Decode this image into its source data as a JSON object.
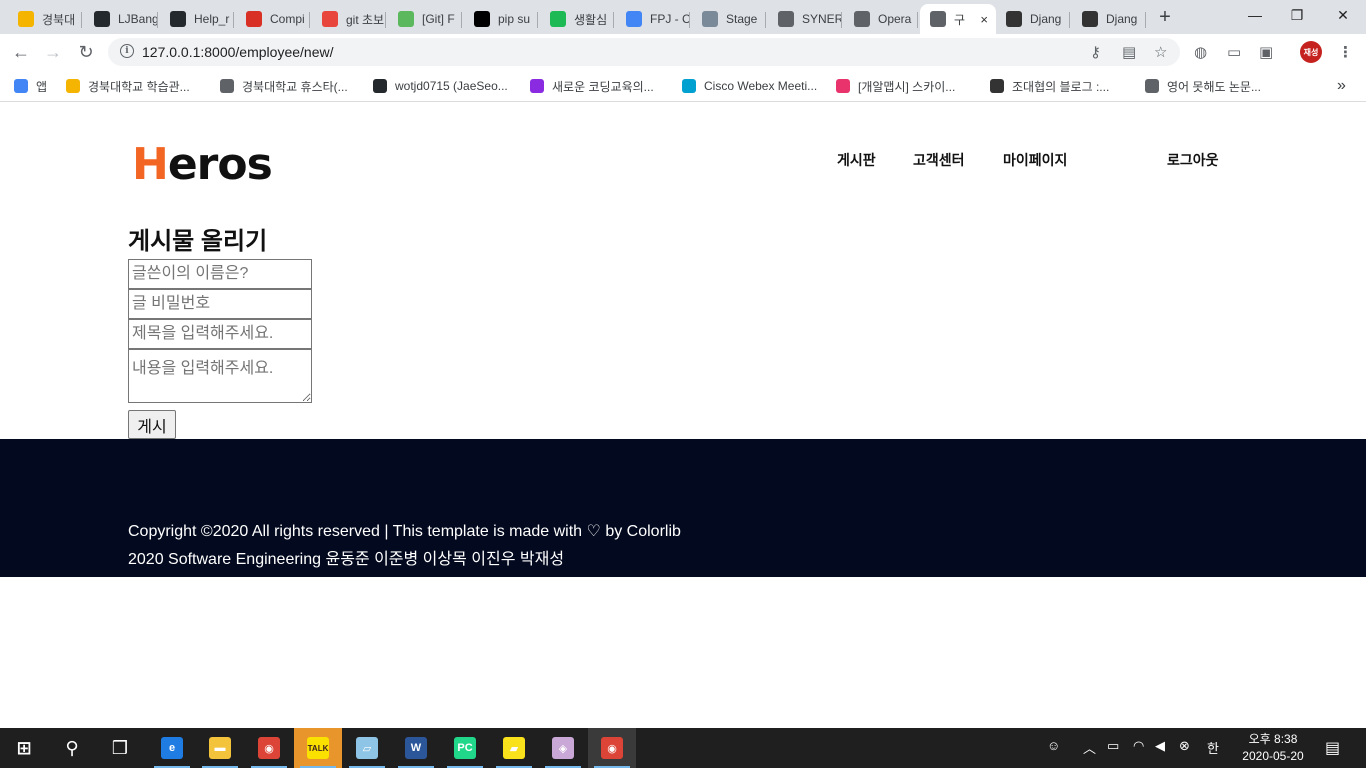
{
  "browser": {
    "tabs": [
      {
        "title": "경북대",
        "icon": "hand-logo-icon",
        "color": "#f4b400"
      },
      {
        "title": "LJBang",
        "icon": "github-icon",
        "color": "#24292e"
      },
      {
        "title": "Help_r",
        "icon": "github-icon",
        "color": "#24292e"
      },
      {
        "title": "Compi",
        "icon": "c-logo-icon",
        "color": "#d93025"
      },
      {
        "title": "git 초보",
        "icon": "git-icon",
        "color": "#e8453c"
      },
      {
        "title": "[Git] F",
        "icon": "bookmark-green-icon",
        "color": "#5cb85c"
      },
      {
        "title": "pip su",
        "icon": "jetbrains-icon",
        "color": "#000000"
      },
      {
        "title": "생활심",
        "icon": "green-app-icon",
        "color": "#1db954"
      },
      {
        "title": "FPJ - C",
        "icon": "google-icon",
        "color": "#4285f4"
      },
      {
        "title": "Stage",
        "icon": "stage-icon",
        "color": "#7a8a99"
      },
      {
        "title": "SYNER",
        "icon": "globe-icon",
        "color": "#5f6368"
      },
      {
        "title": "Opera",
        "icon": "globe-icon",
        "color": "#5f6368"
      },
      {
        "title": "구",
        "icon": "globe-icon",
        "color": "#5f6368",
        "active": true
      },
      {
        "title": "Djang",
        "icon": "django-icon",
        "color": "#333333"
      },
      {
        "title": "Djang",
        "icon": "django-icon",
        "color": "#333333"
      }
    ],
    "close_tab": "×",
    "new_tab": "+",
    "window": {
      "minimize": "—",
      "restore": "❐",
      "close": "✕"
    },
    "nav": {
      "back": "←",
      "forward": "→",
      "reload": "↻"
    },
    "url": "127.0.0.1:8000/employee/new/",
    "profile_label": "재성",
    "bookmarks": [
      {
        "label": "앱",
        "icon": "apps-grid-icon",
        "color": "#4285f4"
      },
      {
        "label": "경북대학교 학습관...",
        "icon": "hand-logo-icon",
        "color": "#f4b400"
      },
      {
        "label": "경북대학교 휴스타(...",
        "icon": "globe-icon",
        "color": "#5f6368"
      },
      {
        "label": "wotjd0715 (JaeSeo...",
        "icon": "github-icon",
        "color": "#24292e"
      },
      {
        "label": "새로운 코딩교육의...",
        "icon": "c-logo-icon",
        "color": "#8a2be2"
      },
      {
        "label": "Cisco Webex Meeti...",
        "icon": "webex-icon",
        "color": "#00a0d1"
      },
      {
        "label": "[개알맵시] 스카이...",
        "icon": "pink-app-icon",
        "color": "#e8336d"
      },
      {
        "label": "조대협의 블로그 :...",
        "icon": "django-icon",
        "color": "#333333"
      },
      {
        "label": "영어 못해도 논문...",
        "icon": "globe-icon",
        "color": "#5f6368"
      }
    ],
    "more_bookmarks": "»"
  },
  "site": {
    "logo_first": "H",
    "logo_rest": "eros",
    "logo_accent": "#f26522",
    "nav": {
      "board": "게시판",
      "support": "고객센터",
      "mypage": "마이페이지",
      "logout": "로그아웃"
    },
    "form": {
      "title": "게시물 올리기",
      "author_placeholder": "글쓴이의 이름은?",
      "password_placeholder": "글 비밀번호",
      "subject_placeholder": "제목을 입력해주세요.",
      "content_placeholder": "내용을 입력해주세요.",
      "submit_label": "게시"
    },
    "footer": {
      "copyright_pre": "Copyright ©2020 All rights reserved | This template is made with",
      "copyright_post": "by Colorlib",
      "credits": "2020 Software Engineering 윤동준 이준병 이상목 이진우 박재성",
      "background": "#03091e"
    }
  },
  "taskbar": {
    "apps": [
      {
        "name": "start",
        "icon": "windows-icon"
      },
      {
        "name": "search",
        "icon": "search-icon"
      },
      {
        "name": "task-view",
        "icon": "task-view-icon"
      },
      {
        "name": "edge",
        "icon": "edge-icon",
        "color": "#1e7ce3"
      },
      {
        "name": "file-explorer",
        "icon": "folder-icon",
        "color": "#f3c33c"
      },
      {
        "name": "chrome",
        "icon": "chrome-icon",
        "color": "#db4437"
      },
      {
        "name": "kakaotalk",
        "icon": "kakaotalk-icon",
        "color": "#fae100",
        "label": "TALK"
      },
      {
        "name": "notepad",
        "icon": "notepad-icon",
        "color": "#8ec5e6"
      },
      {
        "name": "word",
        "icon": "word-icon",
        "color": "#2b579a",
        "label": "W"
      },
      {
        "name": "pycharm",
        "icon": "pycharm-icon",
        "color": "#21d789",
        "label": "PC"
      },
      {
        "name": "sticky-notes",
        "icon": "sticky-notes-icon",
        "color": "#f9e21b"
      },
      {
        "name": "paint",
        "icon": "paint-icon",
        "color": "#c9a7d6"
      },
      {
        "name": "chrome",
        "icon": "chrome-icon",
        "color": "#db4437"
      }
    ],
    "clock_time": "오후 8:38",
    "clock_date": "2020-05-20",
    "ime": "한"
  }
}
